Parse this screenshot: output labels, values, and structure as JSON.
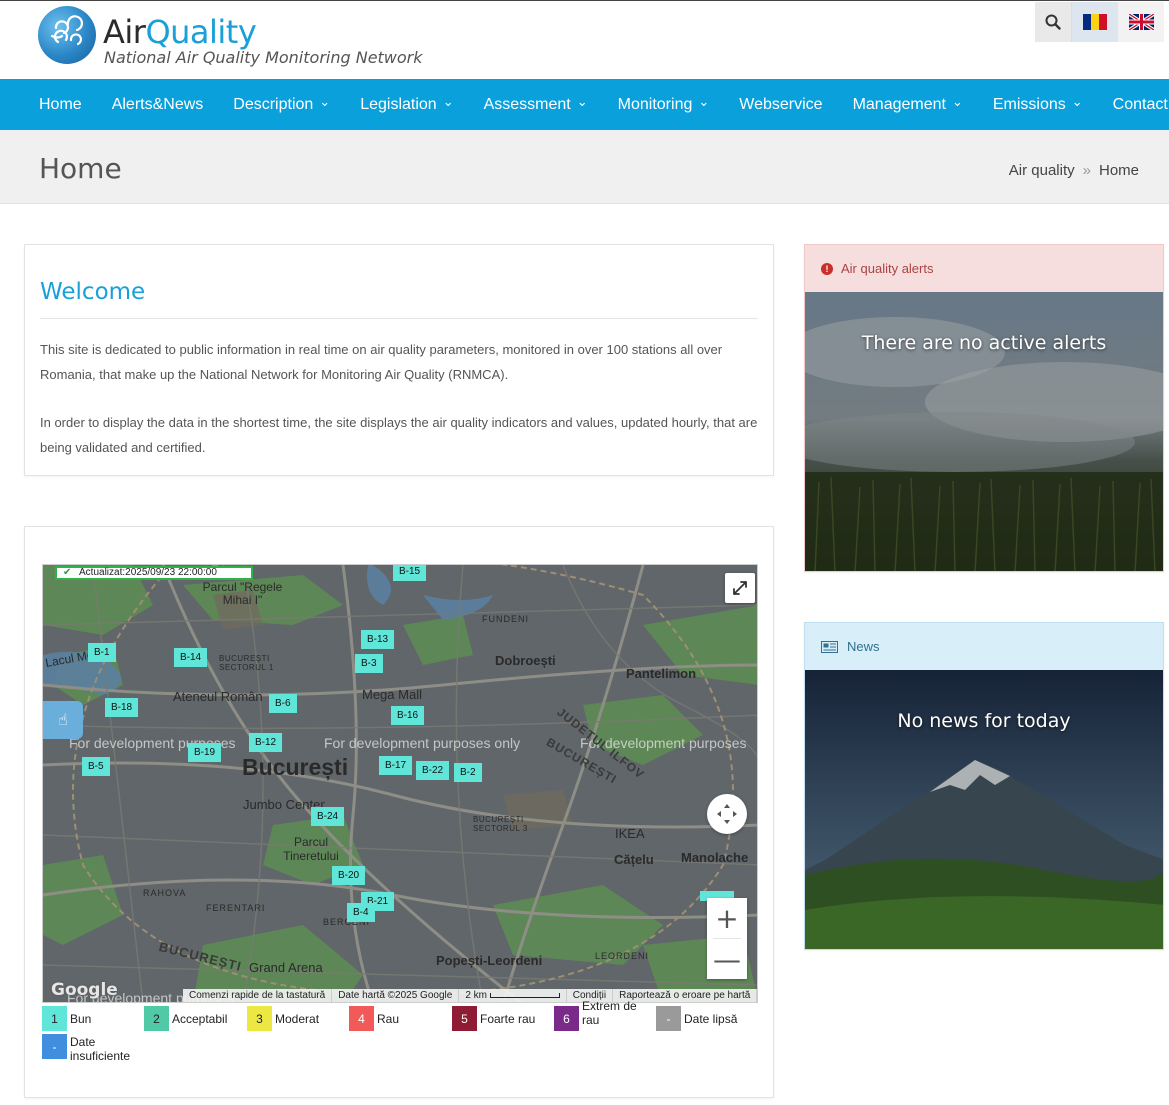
{
  "brand": {
    "title_main": "Air",
    "title_accent": "Quality",
    "subtitle": "National Air Quality Monitoring Network"
  },
  "nav": {
    "items": [
      {
        "label": "Home",
        "dropdown": false
      },
      {
        "label": "Alerts&News",
        "dropdown": false
      },
      {
        "label": "Description",
        "dropdown": true
      },
      {
        "label": "Legislation",
        "dropdown": true
      },
      {
        "label": "Assessment",
        "dropdown": true
      },
      {
        "label": "Monitoring",
        "dropdown": true
      },
      {
        "label": "Webservice",
        "dropdown": false
      },
      {
        "label": "Management",
        "dropdown": true
      },
      {
        "label": "Emissions",
        "dropdown": true
      },
      {
        "label": "Contact",
        "dropdown": false
      }
    ]
  },
  "page": {
    "title": "Home",
    "breadcrumb": [
      "Air quality",
      "Home"
    ],
    "breadcrumb_sep": "»"
  },
  "welcome": {
    "heading": "Welcome",
    "p1": "This site is dedicated to public information in real time on air quality parameters, monitored in over 100 stations all over Romania, that make up the National Network for Monitoring Air Quality (RNMCA).",
    "p2": "In order to display the data in the shortest time, the site displays the air quality indicators and values, updated hourly, that are being validated and certified."
  },
  "map": {
    "updated": "Actualizat:2025/09/23 22:00:00",
    "dev_notice": "For development purposes only",
    "dev_notice_short": "For development purposes",
    "labels": {
      "city": "București",
      "dobroesti": "Dobroești",
      "pantelimon": "Pantelimon",
      "ateneul": "Ateneul Român",
      "mega": "Mega Mall",
      "jumbo": "Jumbo Center",
      "parcul_regele": "Parcul \"Regele Mihai I\"",
      "parcul_tin": "Parcul Tineretului",
      "ikea": "IKEA",
      "catelu": "Cățelu",
      "manolache": "Manolache",
      "grand": "Grand Arena",
      "popesti": "Popești-Leordeni",
      "fundeni": "FUNDENI",
      "rahova": "RAHOVA",
      "ferentari": "FERENTARI",
      "berceni": "BERCENI",
      "sector1": "BUCUREȘTI SECTORUL 1",
      "sector3": "BUCUREȘTI SECTORUL 3",
      "judet": "JUDEȚUL ILFOV",
      "bucuresti_region": "BUCUREȘTI",
      "lacul": "Lacul Morii",
      "leordeni": "LEORDENI"
    },
    "stations": [
      "B-15",
      "B-1",
      "B-14",
      "B-13",
      "B-3",
      "B-18",
      "B-6",
      "B-16",
      "B-12",
      "B-19",
      "B-5",
      "B-17",
      "B-22",
      "B-2",
      "B-24",
      "B-20",
      "B-21",
      "B-4"
    ],
    "footer": [
      "Comenzi rapide de la tastatură",
      "Date hartă ©2025 Google",
      "2 km",
      "Condiții",
      "Raportează o eroare pe hartă"
    ],
    "google": "Google",
    "zoom_in": "+",
    "zoom_out": "—"
  },
  "legend": [
    {
      "num": "1",
      "label": "Bun",
      "color": "#5fe6d9"
    },
    {
      "num": "2",
      "label": "Acceptabil",
      "color": "#4fc9a6"
    },
    {
      "num": "3",
      "label": "Moderat",
      "color": "#ede744"
    },
    {
      "num": "4",
      "label": "Rau",
      "color": "#f25a5a"
    },
    {
      "num": "5",
      "label": "Foarte rau",
      "color": "#8e1c34"
    },
    {
      "num": "6",
      "label": "Extrem de rau",
      "color": "#7a2b8a"
    },
    {
      "num": "-",
      "label": "Date lipsă",
      "color": "#9a9a9a"
    },
    {
      "num": "-",
      "label": "Date insuficiente",
      "color": "#3f8ee0"
    }
  ],
  "alerts": {
    "title": "Air quality alerts",
    "message": "There are no active alerts"
  },
  "news": {
    "title": "News",
    "message": "No news for today"
  }
}
